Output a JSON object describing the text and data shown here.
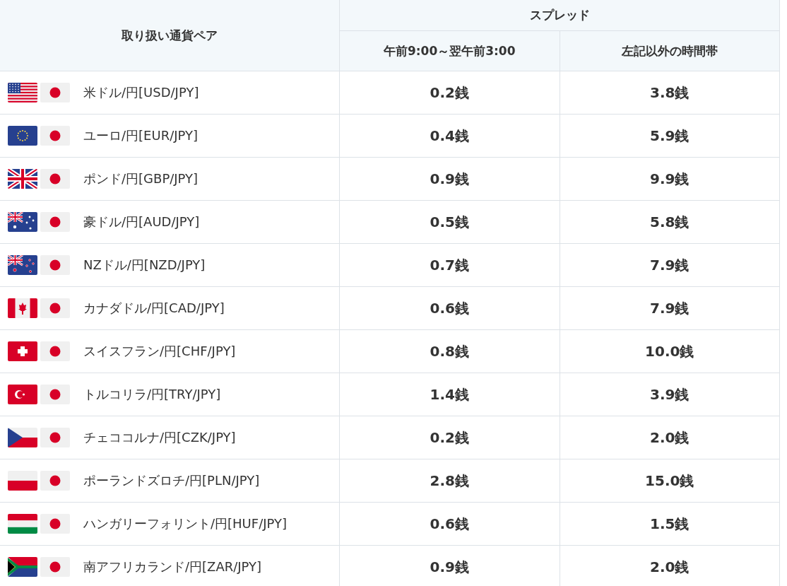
{
  "table": {
    "columns": {
      "pair": "取り扱い通貨ペア",
      "spread": "スプレッド",
      "spread_day": "午前9:00～翌午前3:00",
      "spread_other": "左記以外の時間帯"
    },
    "rows": [
      {
        "kind": "us",
        "pair": "米ドル/円[USD/JPY]",
        "spread_day": "0.2銭",
        "spread_other": "3.8銭"
      },
      {
        "kind": "eu",
        "pair": "ユーロ/円[EUR/JPY]",
        "spread_day": "0.4銭",
        "spread_other": "5.9銭"
      },
      {
        "kind": "gb",
        "pair": "ポンド/円[GBP/JPY]",
        "spread_day": "0.9銭",
        "spread_other": "9.9銭"
      },
      {
        "kind": "au",
        "pair": "豪ドル/円[AUD/JPY]",
        "spread_day": "0.5銭",
        "spread_other": "5.8銭"
      },
      {
        "kind": "nz",
        "pair": "NZドル/円[NZD/JPY]",
        "spread_day": "0.7銭",
        "spread_other": "7.9銭"
      },
      {
        "kind": "ca",
        "pair": "カナダドル/円[CAD/JPY]",
        "spread_day": "0.6銭",
        "spread_other": "7.9銭"
      },
      {
        "kind": "ch",
        "pair": "スイスフラン/円[CHF/JPY]",
        "spread_day": "0.8銭",
        "spread_other": "10.0銭"
      },
      {
        "kind": "tr",
        "pair": "トルコリラ/円[TRY/JPY]",
        "spread_day": "1.4銭",
        "spread_other": "3.9銭"
      },
      {
        "kind": "cz",
        "pair": "チェココルナ/円[CZK/JPY]",
        "spread_day": "0.2銭",
        "spread_other": "2.0銭"
      },
      {
        "kind": "pl",
        "pair": "ポーランドズロチ/円[PLN/JPY]",
        "spread_day": "2.8銭",
        "spread_other": "15.0銭"
      },
      {
        "kind": "hu",
        "pair": "ハンガリーフォリント/円[HUF/JPY]",
        "spread_day": "0.6銭",
        "spread_other": "1.5銭"
      },
      {
        "kind": "za",
        "pair": "南アフリカランド/円[ZAR/JPY]",
        "spread_day": "0.9銭",
        "spread_other": "2.0銭"
      }
    ]
  }
}
